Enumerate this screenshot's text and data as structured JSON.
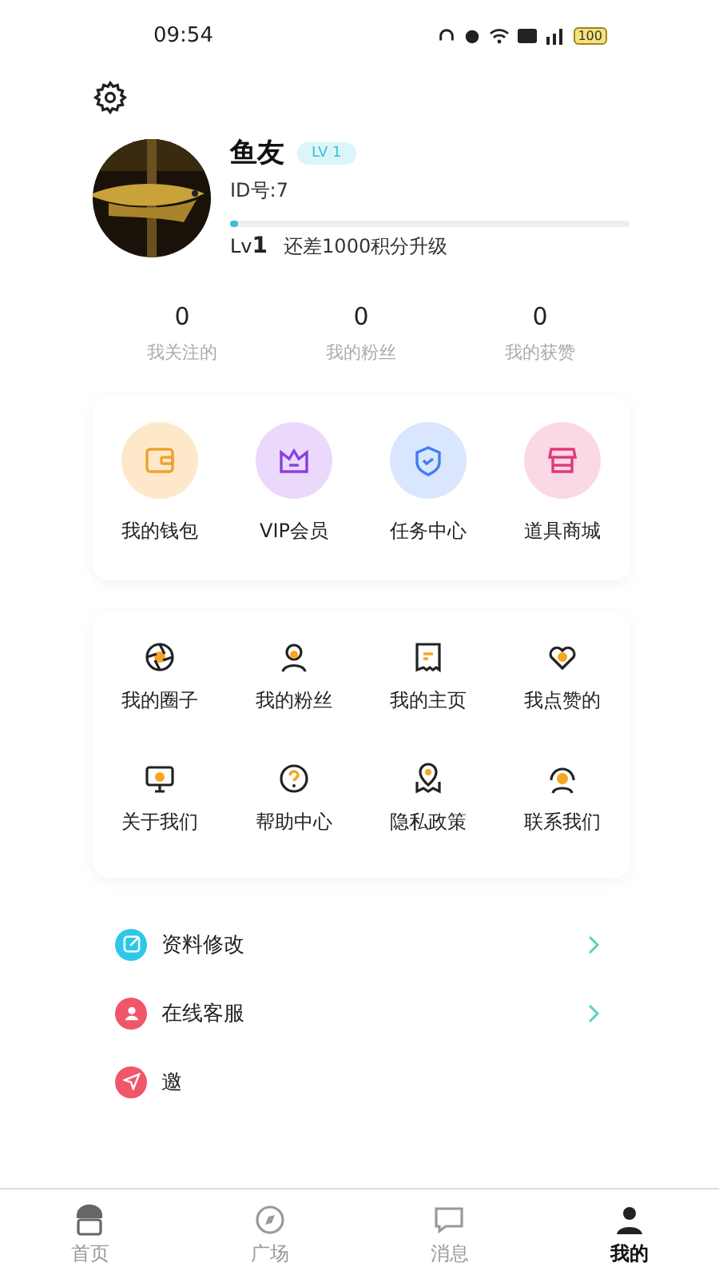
{
  "status_bar": {
    "time": "09:54",
    "battery": "100"
  },
  "profile": {
    "name": "鱼友",
    "badge": "LV 1",
    "id": "ID号:7",
    "level": 0.02,
    "level_prefix": "Lv",
    "level_number": "1",
    "level_hint": "还差1000积分升级"
  },
  "stats": [
    {
      "value": "0",
      "label": "我关注的"
    },
    {
      "value": "0",
      "label": "我的粉丝"
    },
    {
      "value": "0",
      "label": "我的获赞"
    }
  ],
  "features": [
    {
      "label": "我的钱包",
      "kind": "wallet",
      "color": "#fde9c9"
    },
    {
      "label": "VIP会员",
      "kind": "crown",
      "color": "#ead9fb"
    },
    {
      "label": "任务中心",
      "kind": "shield",
      "color": "#d9e6fd"
    },
    {
      "label": "道具商城",
      "kind": "store",
      "color": "#fbd8e6"
    }
  ],
  "menu_grid": [
    {
      "label": "我的圈子",
      "kind": "aperture"
    },
    {
      "label": "我的粉丝",
      "kind": "person"
    },
    {
      "label": "我的主页",
      "kind": "page"
    },
    {
      "label": "我点赞的",
      "kind": "heart"
    },
    {
      "label": "关于我们",
      "kind": "monitor"
    },
    {
      "label": "帮助中心",
      "kind": "help"
    },
    {
      "label": "隐私政策",
      "kind": "location"
    },
    {
      "label": "联系我们",
      "kind": "headset"
    }
  ],
  "settings_list": [
    {
      "label": "资料修改",
      "kind": "edit",
      "color": "#2ec7e8",
      "chevron": true
    },
    {
      "label": "在线客服",
      "kind": "service",
      "color": "#f0566a",
      "chevron": true
    },
    {
      "label": "邀",
      "kind": "send",
      "color": "#f0566a",
      "chevron": false
    }
  ],
  "tab_bar": [
    {
      "label": "首页",
      "selected": false
    },
    {
      "label": "广场",
      "selected": false
    },
    {
      "label": "消息",
      "selected": false
    },
    {
      "label": "我的",
      "selected": true
    }
  ]
}
